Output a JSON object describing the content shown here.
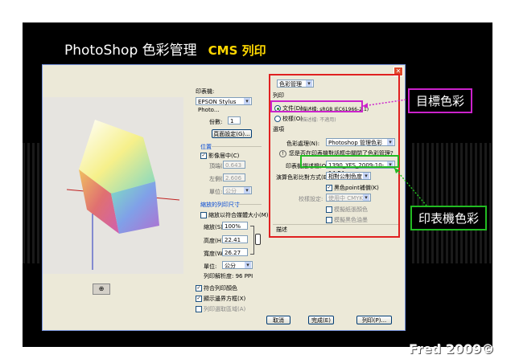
{
  "slide": {
    "title": "PhotoShop 色彩管理",
    "title_highlight": "CMS 列印",
    "footer": "Fred 2009©"
  },
  "annotations": {
    "target_label": "目標色彩",
    "printer_label": "印表機色彩",
    "colors": {
      "red_box": "#e02020",
      "magenta": "#cc22cc",
      "green": "#22bb22"
    }
  },
  "dialog": {
    "printer": {
      "label": "印表機:",
      "value": "EPSON Stylus Photo..."
    },
    "copies": {
      "label": "份數:",
      "value": "1"
    },
    "page_setup_button": "頁面設定(G)...",
    "position": {
      "group_label": "位置",
      "center_label": "影像居中(C)",
      "top_label": "頂端(I):",
      "top_value": "0.643",
      "left_label": "左側(L):",
      "left_value": "2.606",
      "unit_label": "單位:",
      "unit_value": "公分"
    },
    "scaled_size": {
      "group_label": "縮放的列印尺寸",
      "fit_media_label": "縮放以符合媒體大小(M)",
      "scale_label": "縮放(S):",
      "scale_value": "100%",
      "height_label": "高度(H):",
      "height_value": "22.41",
      "width_label": "寬度(W):",
      "width_value": "26.27",
      "unit_label": "單位:",
      "unit_value": "公分",
      "resolution": "列印解析度: 96 PPI"
    },
    "match_print_colors": "符合列印顏色",
    "show_bounding_box": "顯示邊界方框(X)",
    "print_selected_area": "列印選取區域(A)",
    "section_dropdown": "色彩管理",
    "print_label": "列印",
    "document_label": "文件(D)",
    "document_profile": "(描述檔: sRGB IEC61966-2.1)",
    "proof_label": "校樣(O)",
    "proof_profile": "(描述檔: 不適用)",
    "options_label": "選項",
    "color_handling_label": "色彩處理(N):",
    "color_handling_value": "Photoshop 管理色彩",
    "warning_text": "您是否在印表機對話框中關閉了色彩管理?",
    "printer_profile_label": "印表機描述檔(O):",
    "printer_profile_value": "1390_YFS_2009-10-14-F4",
    "rendering_intent_label": "演算色彩比對方式(E):",
    "rendering_intent_value": "相對公制色度",
    "black_point_label": "黑色point補償(K)",
    "proof_setup_label": "校樣設定:",
    "proof_setup_value": "使用中 CMYK",
    "simulate_paper_label": "模擬紙張顏色",
    "simulate_black_label": "模擬黑色油墨",
    "description_label": "描述",
    "buttons": {
      "cancel": "取消",
      "done": "完成(E)",
      "print": "列印(P)..."
    }
  }
}
